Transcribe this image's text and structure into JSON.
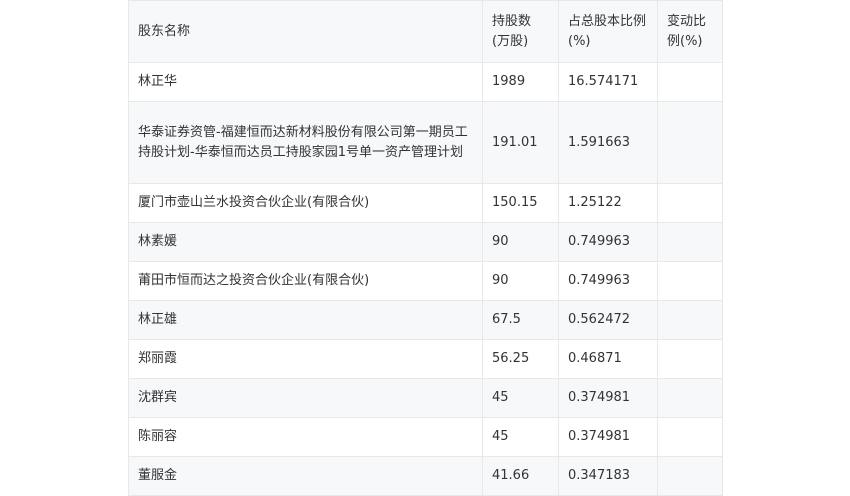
{
  "table": {
    "headers": [
      "股东名称",
      "持股数(万股)",
      "占总股本比例(%)",
      "变动比例(%)"
    ],
    "rows": [
      [
        "林正华",
        "1989",
        "16.574171",
        ""
      ],
      [
        "华泰证券资管-福建恒而达新材料股份有限公司第一期员工持股计划-华泰恒而达员工持股家园1号单一资产管理计划",
        "191.01",
        "1.591663",
        ""
      ],
      [
        "厦门市壶山兰水投资合伙企业(有限合伙)",
        "150.15",
        "1.25122",
        ""
      ],
      [
        "林素媛",
        "90",
        "0.749963",
        ""
      ],
      [
        "莆田市恒而达之投资合伙企业(有限合伙)",
        "90",
        "0.749963",
        ""
      ],
      [
        "林正雄",
        "67.5",
        "0.562472",
        ""
      ],
      [
        "郑丽霞",
        "56.25",
        "0.46871",
        ""
      ],
      [
        "沈群宾",
        "45",
        "0.374981",
        ""
      ],
      [
        "陈丽容",
        "45",
        "0.374981",
        ""
      ],
      [
        "董服金",
        "41.66",
        "0.347183",
        ""
      ]
    ]
  }
}
